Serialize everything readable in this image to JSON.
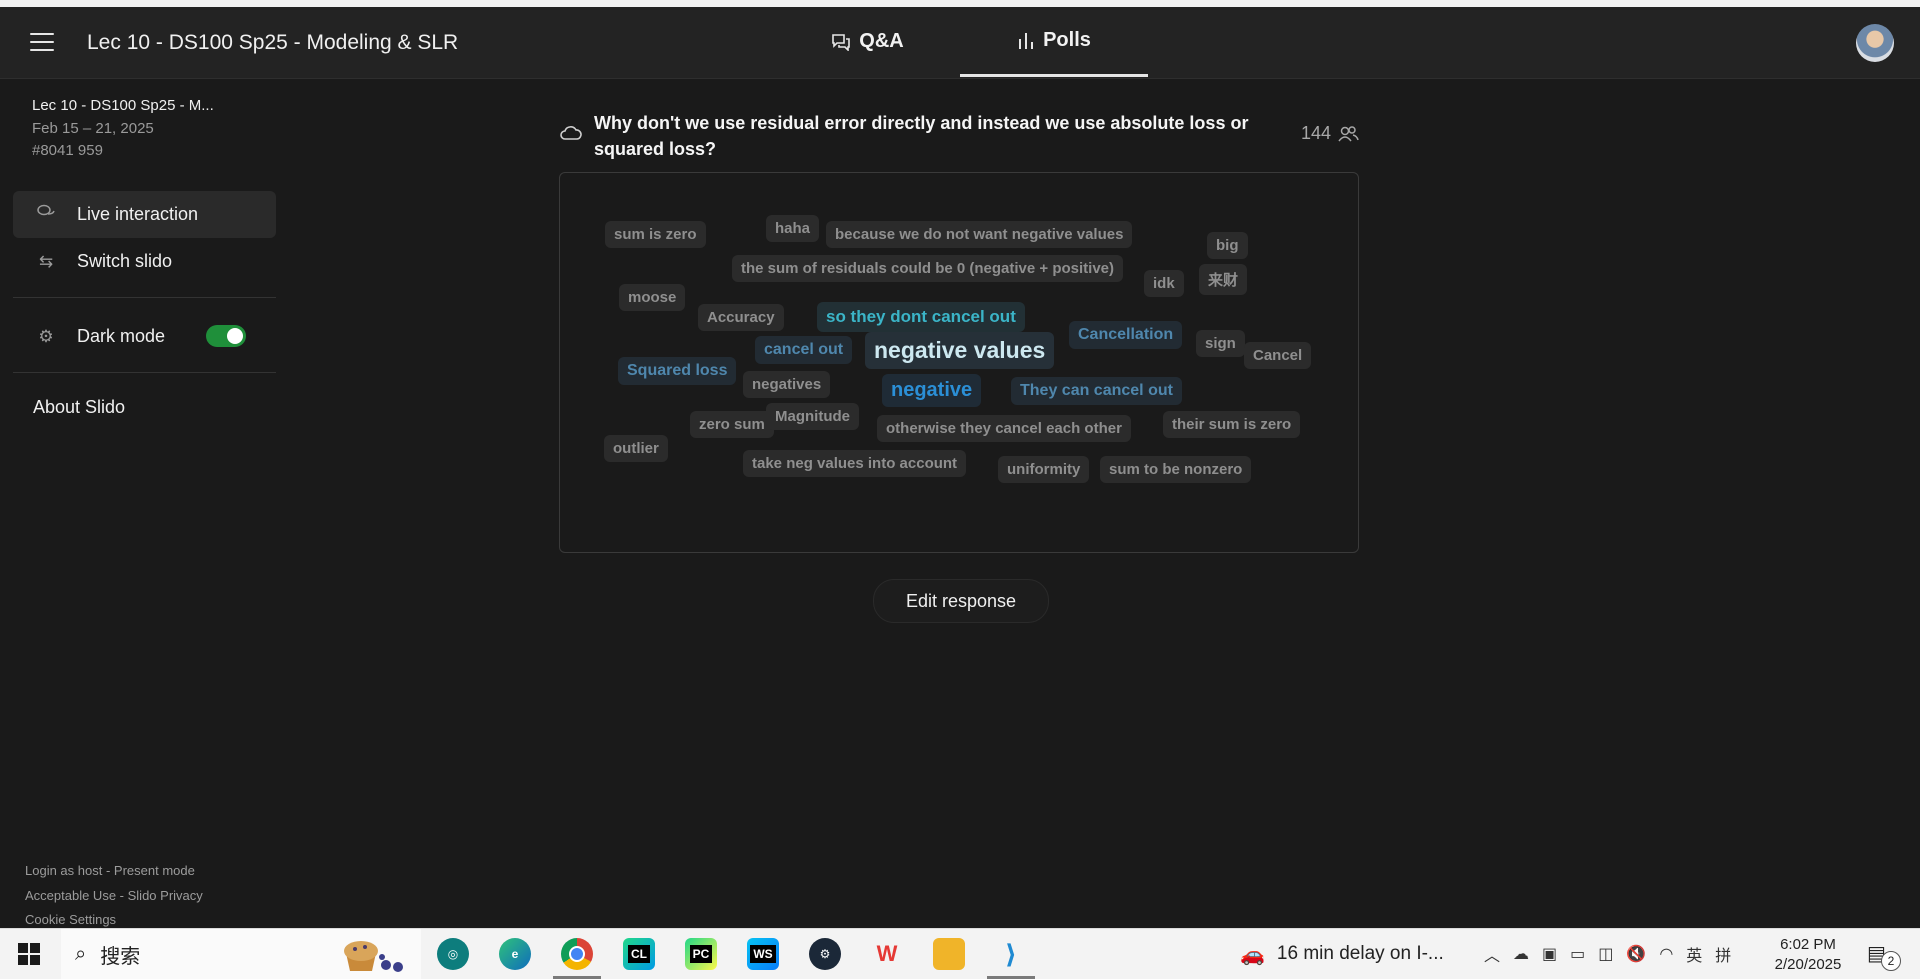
{
  "header": {
    "event_title": "Lec 10 - DS100 Sp25 - Modeling & SLR",
    "tabs": [
      {
        "label": "Q&A",
        "icon": "chat-bubbles-icon"
      },
      {
        "label": "Polls",
        "icon": "bar-chart-icon",
        "active": true
      }
    ]
  },
  "sidebar": {
    "event_name": "Lec 10 - DS100 Sp25 - M...",
    "event_dates": "Feb 15 – 21, 2025",
    "event_code": "#8041 959",
    "items": [
      {
        "label": "Live interaction",
        "icon": "chat-bubbles-icon",
        "active": true
      },
      {
        "label": "Switch slido",
        "icon": "swap-arrows-icon"
      },
      {
        "label": "Dark mode",
        "icon": "settings-gear-icon",
        "toggle_on": true
      }
    ],
    "about": "About Slido",
    "footer": {
      "login": "Login as host",
      "sep": " - ",
      "present": "Present mode",
      "acceptable": "Acceptable Use",
      "privacy": "Slido Privacy",
      "cookies": "Cookie Settings"
    }
  },
  "poll": {
    "icon": "word-cloud-icon",
    "question": "Why don't we use residual error directly and instead we use absolute loss or squared loss?",
    "participants": "144",
    "participants_icon": "people-icon",
    "words": [
      {
        "text": "sum is zero",
        "style": ""
      },
      {
        "text": "haha",
        "style": ""
      },
      {
        "text": "because we do not want negative values",
        "style": ""
      },
      {
        "text": "big",
        "style": ""
      },
      {
        "text": "the sum of residuals could be 0 (negative + positive)",
        "style": ""
      },
      {
        "text": "idk",
        "style": ""
      },
      {
        "text": "来财",
        "style": ""
      },
      {
        "text": "moose",
        "style": ""
      },
      {
        "text": "Accuracy",
        "style": ""
      },
      {
        "text": "so they dont cancel out",
        "style": "teal"
      },
      {
        "text": "Cancellation",
        "style": "steel"
      },
      {
        "text": "sign",
        "style": ""
      },
      {
        "text": "Cancel",
        "style": ""
      },
      {
        "text": "cancel out",
        "style": "steel"
      },
      {
        "text": "negative values",
        "style": "big"
      },
      {
        "text": "Squared loss",
        "style": "steel"
      },
      {
        "text": "negatives",
        "style": ""
      },
      {
        "text": "negative",
        "style": "blue"
      },
      {
        "text": "They can cancel out",
        "style": "steel"
      },
      {
        "text": "zero sum",
        "style": ""
      },
      {
        "text": "Magnitude",
        "style": ""
      },
      {
        "text": "otherwise they cancel each other",
        "style": ""
      },
      {
        "text": "their sum is zero",
        "style": ""
      },
      {
        "text": "outlier",
        "style": ""
      },
      {
        "text": "take neg values into account",
        "style": ""
      },
      {
        "text": "uniformity",
        "style": ""
      },
      {
        "text": "sum to be nonzero",
        "style": ""
      }
    ],
    "edit_button": "Edit response"
  },
  "taskbar": {
    "search_placeholder": "搜索",
    "apps": [
      {
        "name": "chatgpt-app"
      },
      {
        "name": "edge-browser"
      },
      {
        "name": "chrome-browser",
        "active": true
      },
      {
        "name": "clion-ide",
        "label": "CL"
      },
      {
        "name": "pycharm-ide",
        "label": "PC"
      },
      {
        "name": "webstorm-ide",
        "label": "WS"
      },
      {
        "name": "steam-app"
      },
      {
        "name": "wps-office"
      },
      {
        "name": "file-explorer"
      },
      {
        "name": "vscode-app",
        "active": true
      }
    ],
    "traffic_alert": "16 min delay on I-...",
    "ime": "英",
    "ime2": "拼",
    "time": "6:02 PM",
    "date": "2/20/2025",
    "notifications": "2"
  },
  "colors": {
    "background": "#1a1a1a",
    "header": "#232323",
    "toggle_on": "#1f8f3a",
    "accent_blue": "#2b8fd6",
    "accent_teal": "#3bb5c8"
  }
}
